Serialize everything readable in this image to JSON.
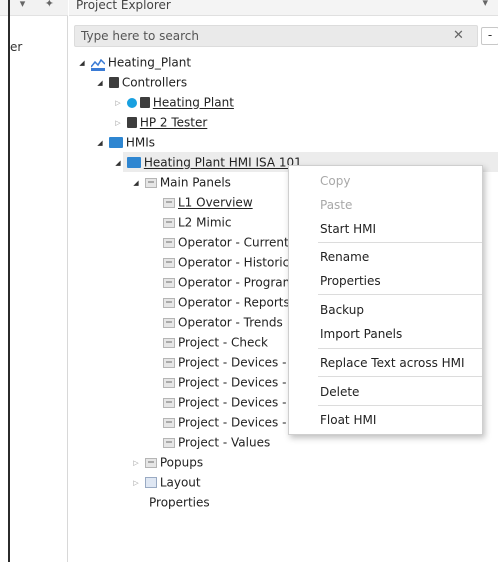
{
  "left_pane": {
    "label": "er"
  },
  "panel": {
    "title": "Project Explorer"
  },
  "search": {
    "placeholder": "Type here to search",
    "clear_symbol": "✕",
    "collapse_symbol": "-"
  },
  "tree": {
    "root": "Heating_Plant",
    "controllers": "Controllers",
    "controller_1": "Heating Plant",
    "controller_2": "HP 2 Tester",
    "hmis": "HMIs",
    "hmi_1": "Heating Plant HMI ISA 101",
    "main_panels": "Main Panels",
    "panels": [
      "L1 Overview",
      "L2 Mimic",
      "Operator - Current",
      "Operator - Historic",
      "Operator - Program",
      "Operator - Reports",
      "Operator - Trends",
      "Project - Check",
      "Project - Devices -",
      "Project - Devices -",
      "Project - Devices -",
      "Project - Devices -",
      "Project - Values"
    ],
    "popups": "Popups",
    "layout": "Layout",
    "properties": "Properties"
  },
  "context_menu": {
    "items": [
      "Copy",
      "Paste",
      "Start HMI",
      "Rename",
      "Properties",
      "Backup",
      "Import Panels",
      "Replace Text across HMI",
      "Delete",
      "Float HMI"
    ]
  },
  "colors": {
    "accent": "#2e86d1",
    "selection": "#ececec",
    "disabled": "#a8a8a8"
  }
}
